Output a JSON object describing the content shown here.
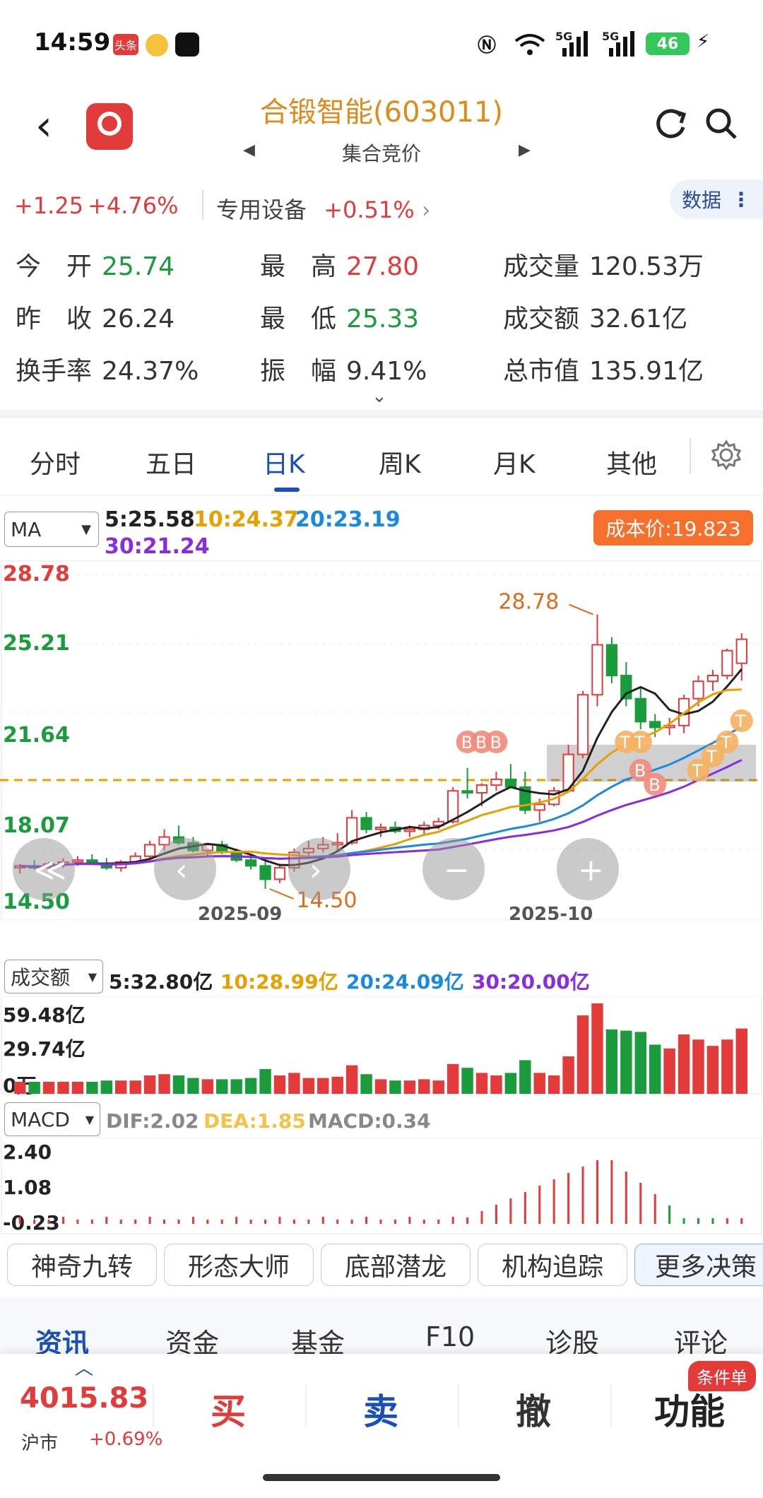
{
  "status": {
    "time": "14:59",
    "app1": "头条",
    "network": "5G",
    "battery": "46"
  },
  "header": {
    "title": "合锻智能(603011)",
    "subtitle": "集合竞价"
  },
  "quote": {
    "change": "+1.25",
    "change_pct": "+4.76%",
    "sector": "专用设备",
    "sector_pct": "+0.51%",
    "data_label": "数据",
    "stats": [
      {
        "k": "今　开",
        "v": "25.74",
        "color": "#1a9c3c"
      },
      {
        "k": "最　高",
        "v": "27.80",
        "color": "#e33a3a"
      },
      {
        "k": "成交量",
        "v": "120.53万",
        "color": "#333333"
      },
      {
        "k": "昨　收",
        "v": "26.24",
        "color": "#333333"
      },
      {
        "k": "最　低",
        "v": "25.33",
        "color": "#1a9c3c"
      },
      {
        "k": "成交额",
        "v": "32.61亿",
        "color": "#333333"
      },
      {
        "k": "换手率",
        "v": "24.37%",
        "color": "#333333"
      },
      {
        "k": "振　幅",
        "v": "9.41%",
        "color": "#333333"
      },
      {
        "k": "总市值",
        "v": "135.91亿",
        "color": "#333333"
      }
    ]
  },
  "tabs": [
    "分时",
    "五日",
    "日K",
    "周K",
    "月K",
    "其他"
  ],
  "kline": {
    "indicator": "MA",
    "ma5": "5:25.58",
    "ma10": "10:24.37",
    "ma20": "20:23.19",
    "ma30": "30:21.24",
    "cost": "成本价:19.823",
    "y_labels": [
      "28.78",
      "25.21",
      "21.64",
      "18.07",
      "14.50"
    ],
    "high_label": "28.78",
    "low_label": "14.50",
    "x_labels": [
      "2025-09",
      "2025-10"
    ]
  },
  "volume": {
    "indicator": "成交额",
    "ma5": "5:32.80亿",
    "ma10": "10:28.99亿",
    "ma20": "20:24.09亿",
    "ma30": "30:20.00亿",
    "y_labels": [
      "59.48亿",
      "29.74亿",
      "0万"
    ]
  },
  "macd": {
    "indicator": "MACD",
    "dif": "DIF:2.02",
    "dea": "DEA:1.85",
    "macd": "MACD:0.34",
    "y_labels": [
      "2.40",
      "1.08",
      "-0.23"
    ]
  },
  "strategy_buttons": [
    "神奇九转",
    "形态大师",
    "底部潜龙",
    "机构追踪",
    "更多决策"
  ],
  "info_tabs": [
    "资讯",
    "资金",
    "基金",
    "F10",
    "诊股",
    "评论"
  ],
  "bottom": {
    "index_value": "4015.83",
    "index_name": "沪市",
    "index_pct": "+0.69%",
    "buy": "买",
    "sell": "卖",
    "cancel": "撤",
    "func": "功能",
    "cond_badge": "条件单"
  },
  "chart_data": {
    "type": "candlestick",
    "candles": [
      [
        15.6,
        15.8,
        15.3,
        15.7
      ],
      [
        15.7,
        16.0,
        15.5,
        15.6
      ],
      [
        15.6,
        15.9,
        15.4,
        15.8
      ],
      [
        15.8,
        16.1,
        15.6,
        15.9
      ],
      [
        15.9,
        16.2,
        15.7,
        16.0
      ],
      [
        16.0,
        16.3,
        15.8,
        15.8
      ],
      [
        15.8,
        16.1,
        15.5,
        15.6
      ],
      [
        15.6,
        16.0,
        15.4,
        15.9
      ],
      [
        15.9,
        16.4,
        15.8,
        16.2
      ],
      [
        16.2,
        17.0,
        16.0,
        16.8
      ],
      [
        16.8,
        17.6,
        16.5,
        17.2
      ],
      [
        17.2,
        17.8,
        16.8,
        16.9
      ],
      [
        16.9,
        17.2,
        16.4,
        16.5
      ],
      [
        16.5,
        16.9,
        16.2,
        16.8
      ],
      [
        16.8,
        17.0,
        16.3,
        16.4
      ],
      [
        16.4,
        16.6,
        15.9,
        16.0
      ],
      [
        16.0,
        16.3,
        15.5,
        15.7
      ],
      [
        15.7,
        16.0,
        14.5,
        15.0
      ],
      [
        15.0,
        15.8,
        14.8,
        15.6
      ],
      [
        15.6,
        16.6,
        15.4,
        16.4
      ],
      [
        16.4,
        17.0,
        16.2,
        16.6
      ],
      [
        16.6,
        17.2,
        16.4,
        16.8
      ],
      [
        16.8,
        17.4,
        16.5,
        16.9
      ],
      [
        16.9,
        18.6,
        16.8,
        18.2
      ],
      [
        18.2,
        18.5,
        17.4,
        17.6
      ],
      [
        17.6,
        17.9,
        17.2,
        17.7
      ],
      [
        17.7,
        18.0,
        17.4,
        17.5
      ],
      [
        17.5,
        17.8,
        17.2,
        17.6
      ],
      [
        17.6,
        18.0,
        17.3,
        17.8
      ],
      [
        17.8,
        18.2,
        17.6,
        18.0
      ],
      [
        18.0,
        19.8,
        17.9,
        19.6
      ],
      [
        19.6,
        20.8,
        19.2,
        19.5
      ],
      [
        19.5,
        20.0,
        18.8,
        19.9
      ],
      [
        19.9,
        20.6,
        19.6,
        20.2
      ],
      [
        20.2,
        21.0,
        19.8,
        19.8
      ],
      [
        19.8,
        20.6,
        18.4,
        18.6
      ],
      [
        18.6,
        19.2,
        18.0,
        18.9
      ],
      [
        18.9,
        19.8,
        18.8,
        19.6
      ],
      [
        19.6,
        22.0,
        19.5,
        21.5
      ],
      [
        21.5,
        24.8,
        21.3,
        24.6
      ],
      [
        24.6,
        28.78,
        24.0,
        27.2
      ],
      [
        27.2,
        27.6,
        25.2,
        25.6
      ],
      [
        25.6,
        26.3,
        24.0,
        24.4
      ],
      [
        24.4,
        25.0,
        22.8,
        23.2
      ],
      [
        23.2,
        23.6,
        22.4,
        22.9
      ],
      [
        22.9,
        23.4,
        22.5,
        23.0
      ],
      [
        23.0,
        24.6,
        22.6,
        24.4
      ],
      [
        24.4,
        25.6,
        24.0,
        25.3
      ],
      [
        25.3,
        25.9,
        24.8,
        25.6
      ],
      [
        25.6,
        27.0,
        25.4,
        26.9
      ],
      [
        26.24,
        27.8,
        25.33,
        27.49
      ]
    ],
    "ylim": [
      14.5,
      28.78
    ]
  }
}
